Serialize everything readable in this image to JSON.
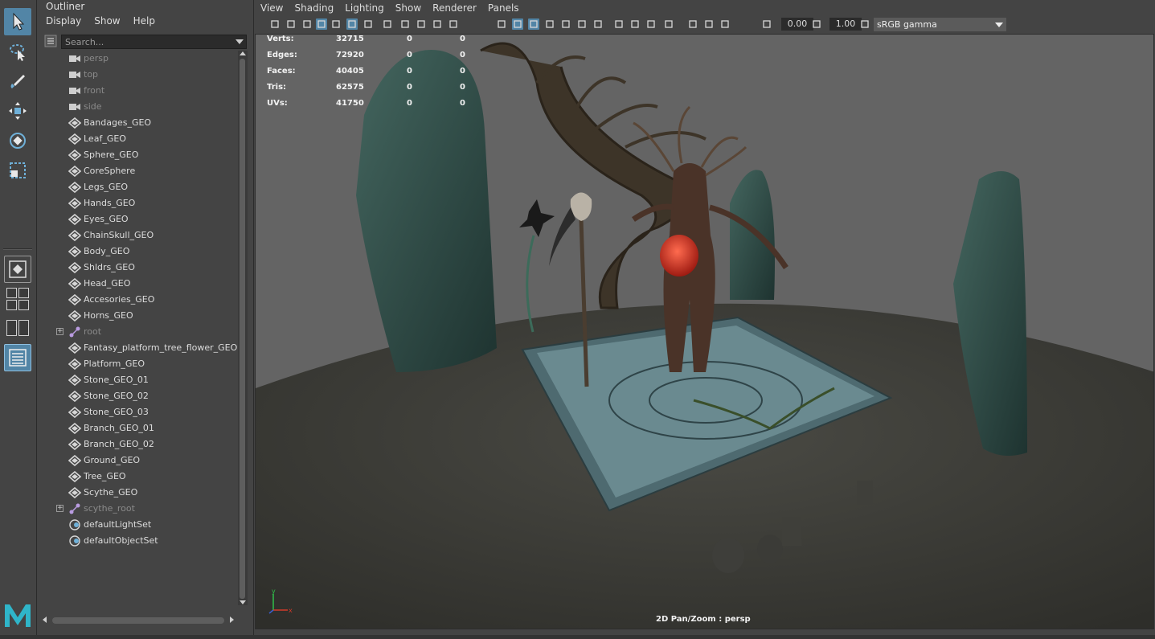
{
  "outliner": {
    "title": "Outliner",
    "menu": [
      "Display",
      "Show",
      "Help"
    ],
    "search_placeholder": "Search...",
    "items": [
      {
        "label": "persp",
        "type": "camera",
        "dim": true
      },
      {
        "label": "top",
        "type": "camera",
        "dim": true
      },
      {
        "label": "front",
        "type": "camera",
        "dim": true
      },
      {
        "label": "side",
        "type": "camera",
        "dim": true
      },
      {
        "label": "Bandages_GEO",
        "type": "mesh"
      },
      {
        "label": "Leaf_GEO",
        "type": "mesh"
      },
      {
        "label": "Sphere_GEO",
        "type": "mesh"
      },
      {
        "label": "CoreSphere",
        "type": "mesh"
      },
      {
        "label": "Legs_GEO",
        "type": "mesh"
      },
      {
        "label": "Hands_GEO",
        "type": "mesh"
      },
      {
        "label": "Eyes_GEO",
        "type": "mesh"
      },
      {
        "label": "ChainSkull_GEO",
        "type": "mesh"
      },
      {
        "label": "Body_GEO",
        "type": "mesh"
      },
      {
        "label": "Shldrs_GEO",
        "type": "mesh"
      },
      {
        "label": "Head_GEO",
        "type": "mesh"
      },
      {
        "label": "Accesories_GEO",
        "type": "mesh"
      },
      {
        "label": "Horns_GEO",
        "type": "mesh"
      },
      {
        "label": "root",
        "type": "joint",
        "dim": true,
        "expandable": true
      },
      {
        "label": "Fantasy_platform_tree_flower_GEO",
        "type": "mesh"
      },
      {
        "label": "Platform_GEO",
        "type": "mesh"
      },
      {
        "label": "Stone_GEO_01",
        "type": "mesh"
      },
      {
        "label": "Stone_GEO_02",
        "type": "mesh"
      },
      {
        "label": "Stone_GEO_03",
        "type": "mesh"
      },
      {
        "label": "Branch_GEO_01",
        "type": "mesh"
      },
      {
        "label": "Branch_GEO_02",
        "type": "mesh"
      },
      {
        "label": "Ground_GEO",
        "type": "mesh"
      },
      {
        "label": "Tree_GEO",
        "type": "mesh"
      },
      {
        "label": "Scythe_GEO",
        "type": "mesh"
      },
      {
        "label": "scythe_root",
        "type": "joint",
        "dim": true,
        "expandable": true
      },
      {
        "label": "defaultLightSet",
        "type": "set"
      },
      {
        "label": "defaultObjectSet",
        "type": "set"
      }
    ]
  },
  "panel": {
    "menu": [
      "View",
      "Shading",
      "Lighting",
      "Show",
      "Renderer",
      "Panels"
    ],
    "exposure": "0.00",
    "gamma": "1.00",
    "color_space": "sRGB gamma"
  },
  "hud": [
    {
      "label": "Verts:",
      "v1": "32715",
      "v2": "0",
      "v3": "0"
    },
    {
      "label": "Edges:",
      "v1": "72920",
      "v2": "0",
      "v3": "0"
    },
    {
      "label": "Faces:",
      "v1": "40405",
      "v2": "0",
      "v3": "0"
    },
    {
      "label": "Tris:",
      "v1": "62575",
      "v2": "0",
      "v3": "0"
    },
    {
      "label": "UVs:",
      "v1": "41750",
      "v2": "0",
      "v3": "0"
    }
  ],
  "camera_label": "2D Pan/Zoom : persp",
  "axis_labels": {
    "y": "y",
    "x": "x"
  },
  "colors": {
    "active_tool": "#5285a6",
    "viewport_bg": "#646464",
    "ground": "#3a3a35",
    "stone": "#2f4a48",
    "platform": "#5d7a80",
    "orb": "#d23a2a"
  }
}
